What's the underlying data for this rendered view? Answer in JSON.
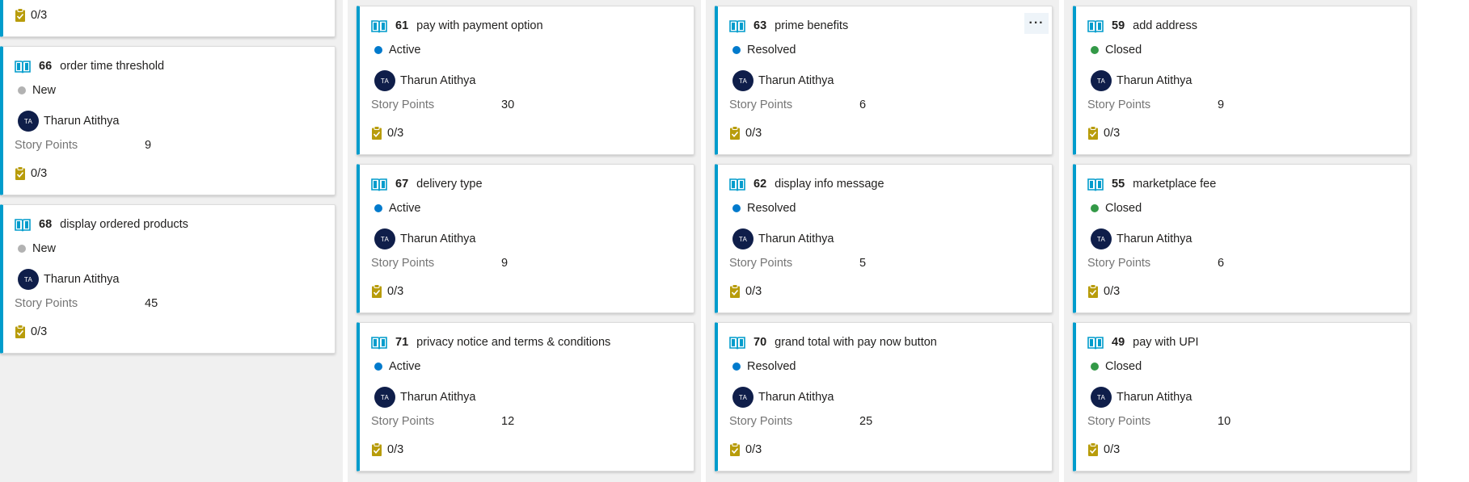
{
  "colors": {
    "accent_border": "#009ccc",
    "state_new": "#b2b2b2",
    "state_active": "#007acc",
    "state_resolved": "#007acc",
    "state_closed": "#339947",
    "avatar_bg": "#0f1e4a",
    "task_icon": "#b89c0b",
    "book_icon": "#009ccc"
  },
  "labels": {
    "story_points": "Story Points",
    "more": "···"
  },
  "cards": [
    {
      "id": "",
      "title": "",
      "state": "",
      "assignee": "",
      "avatar_initials": "",
      "story_points": "",
      "tasks": "0/3"
    },
    {
      "id": "66",
      "title": "order time threshold",
      "state": "New",
      "assignee": "Tharun Atithya",
      "avatar_initials": "TA",
      "story_points": "9",
      "tasks": "0/3"
    },
    {
      "id": "68",
      "title": "display ordered products",
      "state": "New",
      "assignee": "Tharun Atithya",
      "avatar_initials": "TA",
      "story_points": "45",
      "tasks": "0/3"
    },
    {
      "id": "61",
      "title": "pay with payment option",
      "state": "Active",
      "assignee": "Tharun Atithya",
      "avatar_initials": "TA",
      "story_points": "30",
      "tasks": "0/3"
    },
    {
      "id": "67",
      "title": "delivery type",
      "state": "Active",
      "assignee": "Tharun Atithya",
      "avatar_initials": "TA",
      "story_points": "9",
      "tasks": "0/3"
    },
    {
      "id": "71",
      "title": "privacy notice and terms & conditions",
      "state": "Active",
      "assignee": "Tharun Atithya",
      "avatar_initials": "TA",
      "story_points": "12",
      "tasks": "0/3"
    },
    {
      "id": "63",
      "title": "prime benefits",
      "state": "Resolved",
      "assignee": "Tharun Atithya",
      "avatar_initials": "TA",
      "story_points": "6",
      "tasks": "0/3"
    },
    {
      "id": "62",
      "title": "display info message",
      "state": "Resolved",
      "assignee": "Tharun Atithya",
      "avatar_initials": "TA",
      "story_points": "5",
      "tasks": "0/3"
    },
    {
      "id": "70",
      "title": "grand total with pay now button",
      "state": "Resolved",
      "assignee": "Tharun Atithya",
      "avatar_initials": "TA",
      "story_points": "25",
      "tasks": "0/3"
    },
    {
      "id": "59",
      "title": "add address",
      "state": "Closed",
      "assignee": "Tharun Atithya",
      "avatar_initials": "TA",
      "story_points": "9",
      "tasks": "0/3"
    },
    {
      "id": "55",
      "title": "marketplace fee",
      "state": "Closed",
      "assignee": "Tharun Atithya",
      "avatar_initials": "TA",
      "story_points": "6",
      "tasks": "0/3"
    },
    {
      "id": "49",
      "title": "pay with UPI",
      "state": "Closed",
      "assignee": "Tharun Atithya",
      "avatar_initials": "TA",
      "story_points": "10",
      "tasks": "0/3"
    }
  ]
}
